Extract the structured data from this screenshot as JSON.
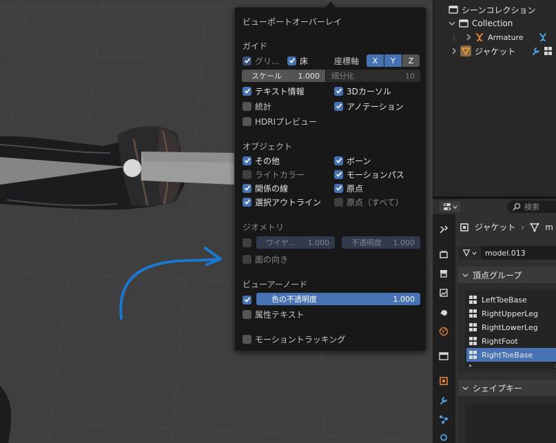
{
  "overlay": {
    "title": "ビューポートオーバーレイ",
    "guides": {
      "heading": "ガイド",
      "grid": "グリ...",
      "floor": "床",
      "axes_label": "座標軸",
      "axes": [
        "X",
        "Y",
        "Z"
      ],
      "scale_label": "スケール",
      "scale_value": "1.000",
      "subdivision_label": "細分化",
      "subdivision_value": "10",
      "text_info": "テキスト情報",
      "cursor_3d": "3Dカーソル",
      "statistics": "統計",
      "annotations": "アノテーション",
      "hdri_preview": "HDRIプレビュー"
    },
    "objects": {
      "heading": "オブジェクト",
      "extras": "その他",
      "bones": "ボーン",
      "light_colors": "ライトカラー",
      "motion_paths": "モーションパス",
      "relationship_lines": "関係の線",
      "origins": "原点",
      "outline_selected": "選択アウトライン",
      "origins_all": "原点（すべて）"
    },
    "geometry": {
      "heading": "ジオメトリ",
      "wireframe_label": "ワイヤ...",
      "wireframe_value": "1.000",
      "opacity_label": "不透明度",
      "opacity_value": "1.000",
      "face_orientation": "面の向き"
    },
    "viewer_node": {
      "heading": "ビューアーノード",
      "color_opacity_label": "色の不透明度",
      "color_opacity_value": "1.000",
      "attribute_text": "属性テキスト"
    },
    "motion_tracking": "モーショントラッキング"
  },
  "outliner": {
    "scene_collection": "シーンコレクション",
    "collection": "Collection",
    "armature": "Armature",
    "jacket": "ジャケット"
  },
  "properties": {
    "search_placeholder": "検索",
    "breadcrumb_object": "ジャケット",
    "breadcrumb_mesh": "m",
    "mesh_name": "model.013",
    "vertex_groups_heading": "頂点グループ",
    "vertex_groups": [
      "LeftToeBase",
      "RightUpperLeg",
      "RightLowerLeg",
      "RightFoot",
      "RightToeBase"
    ],
    "shape_keys_heading": "シェイプキー"
  },
  "colors": {
    "accent": "#4772b3",
    "annotation_stroke": "#1a78d0",
    "armature_icon": "#e8873a",
    "mesh_icon": "#e8873a"
  }
}
